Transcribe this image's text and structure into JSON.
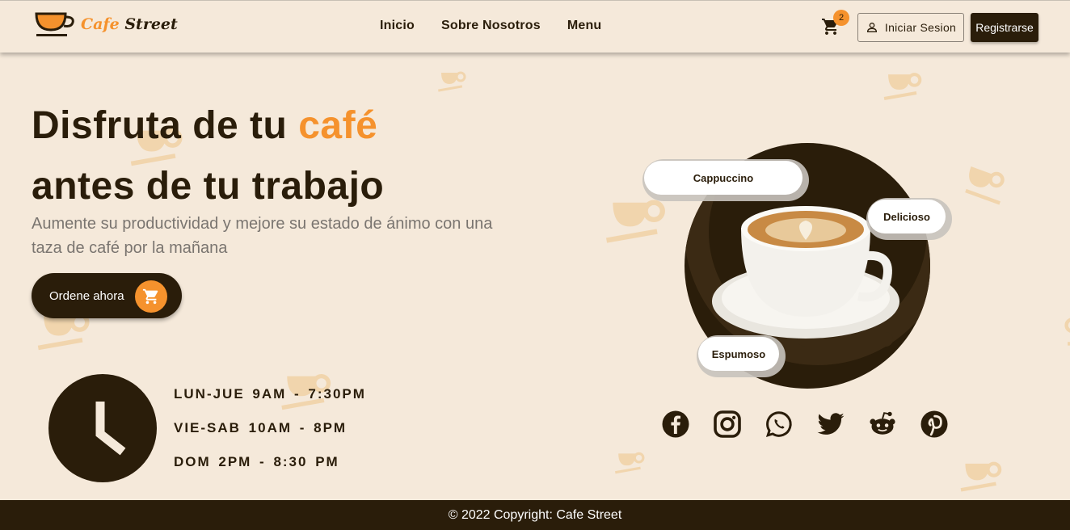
{
  "header": {
    "logo_text_accent": "Cafe",
    "logo_text_main": "Street",
    "nav": [
      "Inicio",
      "Sobre Nosotros",
      "Menu"
    ],
    "cart_icon": "cart-icon",
    "cart_count": "2",
    "login_label": "Iniciar Sesion",
    "register_label": "Registrarse"
  },
  "hero": {
    "title_line1_start": "Disfruta de tu",
    "title_line1_accent": "café",
    "title_line2": "antes de tu trabajo",
    "subtitle": "Aumente su productividad y mejore su estado de ánimo con una taza de café por la mañana",
    "order_label": "Ordene ahora"
  },
  "schedule": {
    "rows": [
      "LUN-JUE  9AM  -  7:30PM",
      "VIE-SAB  10AM  -  8PM",
      "DOM  2PM  -  8:30  PM"
    ]
  },
  "coffee": {
    "tags": [
      "Cappuccino",
      "Delicioso",
      "Espumoso"
    ]
  },
  "social": {
    "icons": [
      "facebook-icon",
      "instagram-icon",
      "whatsapp-icon",
      "twitter-icon",
      "reddit-icon",
      "pinterest-icon"
    ]
  },
  "footer": {
    "text": "© 2022 Copyright: Cafe Street"
  },
  "colors": {
    "background": "#f5e9da",
    "dark_brown": "#2a1d0a",
    "accent_orange": "#f5922d"
  }
}
